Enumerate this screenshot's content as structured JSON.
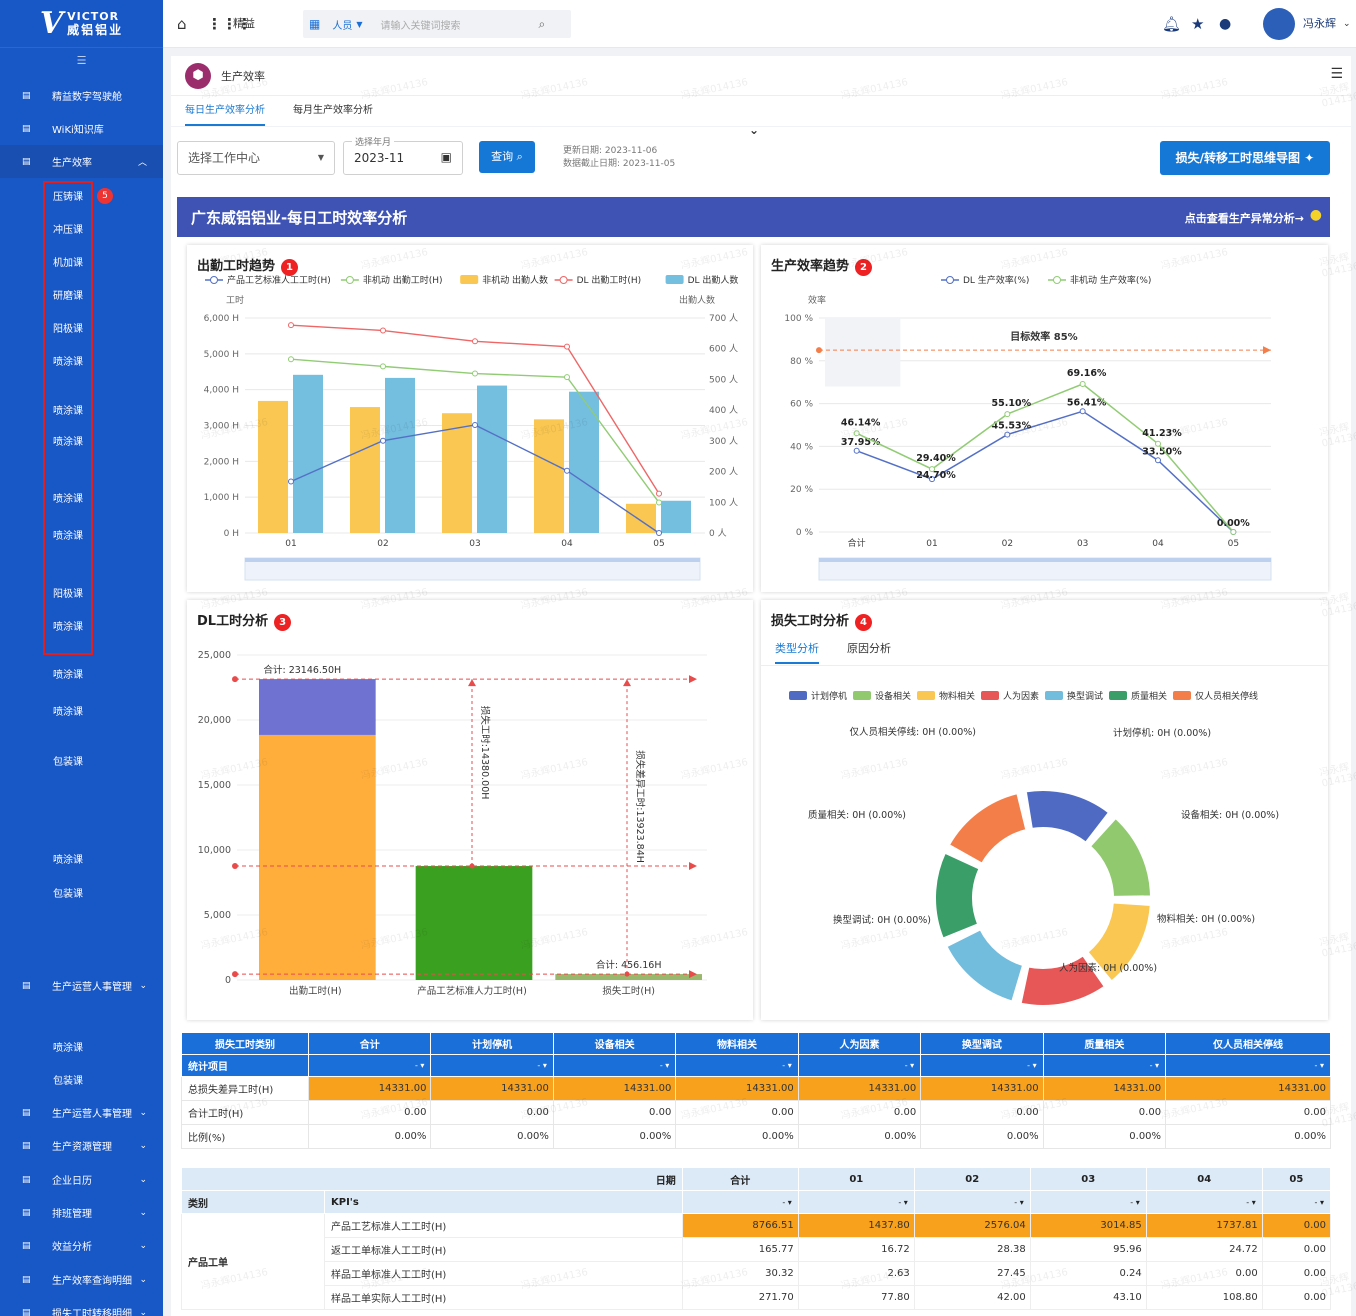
{
  "brand": {
    "logo_line1": "VICTOR",
    "logo_line2": "威铝铝业"
  },
  "sidebar": {
    "items": [
      {
        "label": "精益数字驾驶舱",
        "top": 79
      },
      {
        "label": "WiKi知识库",
        "top": 112
      },
      {
        "label": "生产效率",
        "top": 145,
        "expanded": true
      },
      {
        "label": "生产运营人事管理",
        "top": 969
      },
      {
        "label": "生产运营人事管理",
        "top": 1096
      },
      {
        "label": "生产资源管理",
        "top": 1129
      },
      {
        "label": "企业日历",
        "top": 1163
      },
      {
        "label": "排班管理",
        "top": 1196
      },
      {
        "label": "效益分析",
        "top": 1229
      },
      {
        "label": "生产效率查询明细",
        "top": 1263
      },
      {
        "label": "损失工时转移明细",
        "top": 1296
      }
    ],
    "subitems": [
      {
        "label": "压铸课",
        "top": 179
      },
      {
        "label": "冲压课",
        "top": 212
      },
      {
        "label": "机加课",
        "top": 245
      },
      {
        "label": "研磨课",
        "top": 278
      },
      {
        "label": "阳极课",
        "top": 311
      },
      {
        "label": "喷涂课",
        "top": 344
      },
      {
        "label": "喷涂课",
        "top": 393
      },
      {
        "label": "喷涂课",
        "top": 424
      },
      {
        "label": "喷涂课",
        "top": 481
      },
      {
        "label": "喷涂课",
        "top": 518
      },
      {
        "label": "阳极课",
        "top": 576
      },
      {
        "label": "喷涂课",
        "top": 609
      },
      {
        "label": "喷涂课",
        "top": 657
      },
      {
        "label": "喷涂课",
        "top": 694
      },
      {
        "label": "包装课",
        "top": 744
      },
      {
        "label": "喷涂课",
        "top": 842
      },
      {
        "label": "包装课",
        "top": 876
      },
      {
        "label": "喷涂课",
        "top": 1030
      },
      {
        "label": "包装课",
        "top": 1063
      }
    ],
    "badge": "5"
  },
  "topbar": {
    "module": "精益",
    "search_scope": "人员",
    "search_placeholder": "请输入关键词搜索",
    "user": "冯永辉"
  },
  "page": {
    "breadcrumb": "生产效率",
    "tabs": [
      "每日生产效率分析",
      "每月生产效率分析"
    ],
    "active_tab": 0
  },
  "filters": {
    "work_center_placeholder": "选择工作中心",
    "month_label": "选择年月",
    "month_value": "2023-11",
    "query_label": "查询",
    "update_date": "更新日期: 2023-11-06",
    "cutoff_date": "数据截止日期: 2023-11-05",
    "mindmap_button": "损失/转移工时思维导图"
  },
  "banner": {
    "title": "广东威铝铝业-每日工时效率分析",
    "link": "点击查看生产异常分析→"
  },
  "panels": {
    "p1": {
      "title": "出勤工时趋势",
      "badge": "1"
    },
    "p2": {
      "title": "生产效率趋势",
      "badge": "2"
    },
    "p3": {
      "title": "DL工时分析",
      "badge": "3"
    },
    "p4": {
      "title": "损失工时分析",
      "badge": "4",
      "tabs": [
        "类型分析",
        "原因分析"
      ]
    }
  },
  "chart_data": [
    {
      "type": "bar",
      "title": "出勤工时趋势",
      "categories": [
        "01",
        "02",
        "03",
        "04",
        "05"
      ],
      "ylabel": "工时",
      "ylabel_right": "出勤人数",
      "y_ticks": [
        "6,000 H",
        "5,000 H",
        "4,000 H",
        "3,000 H",
        "2,000 H",
        "1,000 H",
        "0 H"
      ],
      "y2_ticks": [
        "700 人",
        "600 人",
        "500 人",
        "400 人",
        "300 人",
        "200 人",
        "100 人",
        "0 人"
      ],
      "ylim": [
        0,
        6000
      ],
      "y2lim": [
        0,
        700
      ],
      "legend": [
        "产品工艺标准人工工时(H)",
        "非机动 出勤工时(H)",
        "非机动 出勤人数",
        "DL 出勤工时(H)",
        "DL 出勤人数"
      ],
      "series": [
        {
          "name": "非机动 出勤人数",
          "kind": "bar",
          "axis": "right",
          "color": "#f9c752",
          "values": [
            430,
            410,
            390,
            370,
            95
          ]
        },
        {
          "name": "DL 出勤人数",
          "kind": "bar",
          "axis": "right",
          "color": "#74bedf",
          "values": [
            515,
            505,
            480,
            460,
            105
          ]
        },
        {
          "name": "产品工艺标准人工工时(H)",
          "kind": "line",
          "axis": "left",
          "color": "#5470c6",
          "values": [
            1438,
            2576,
            3015,
            1738,
            0
          ]
        },
        {
          "name": "非机动 出勤工时(H)",
          "kind": "line",
          "axis": "left",
          "color": "#91cc75",
          "values": [
            4850,
            4650,
            4450,
            4350,
            850
          ]
        },
        {
          "name": "DL 出勤工时(H)",
          "kind": "line",
          "axis": "left",
          "color": "#ee6666",
          "values": [
            5800,
            5650,
            5350,
            5200,
            1100
          ]
        }
      ]
    },
    {
      "type": "line",
      "title": "生产效率趋势",
      "categories": [
        "合计",
        "01",
        "02",
        "03",
        "04",
        "05"
      ],
      "ylabel": "效率",
      "y_ticks": [
        "100 %",
        "80 %",
        "60 %",
        "40 %",
        "20 %",
        "0 %"
      ],
      "ylim": [
        0,
        100
      ],
      "target_label": "目标效率 85%",
      "target": 85,
      "series": [
        {
          "name": "DL 生产效率(%)",
          "color": "#5470c6",
          "values": [
            37.95,
            24.7,
            45.53,
            56.41,
            33.5,
            0.0
          ],
          "labels": [
            "37.95%",
            "24.70%",
            "45.53%",
            "56.41%",
            "33.50%",
            "0.00%"
          ]
        },
        {
          "name": "非机动 生产效率(%)",
          "color": "#91cc75",
          "values": [
            46.14,
            29.4,
            55.1,
            69.16,
            41.23,
            0.0
          ],
          "labels": [
            "46.14%",
            "29.40%",
            "55.10%",
            "69.16%",
            "41.23%",
            ""
          ]
        }
      ]
    },
    {
      "type": "bar",
      "title": "DL工时分析",
      "categories": [
        "出勤工时(H)",
        "产品工艺标准人力工时(H)",
        "损失工时(H)"
      ],
      "y_ticks": [
        "25,000",
        "20,000",
        "15,000",
        "10,000",
        "5,000",
        "0"
      ],
      "ylim": [
        0,
        25000
      ],
      "stacks": [
        [
          {
            "value": 18850,
            "color": "#ffae3b"
          },
          {
            "value": 4296.5,
            "color": "#6f72d0"
          }
        ],
        [
          {
            "value": 8766.51,
            "color": "#3aa020"
          }
        ],
        [
          {
            "value": 456.16,
            "color": "#9ab86b"
          }
        ]
      ],
      "totals": [
        "合计: 23146.50H",
        "",
        "合计: 456.16H"
      ],
      "annotations": [
        "损失工时:14380.00H",
        "损失差异工时:13923.84H"
      ]
    },
    {
      "type": "pie",
      "title": "损失工时分析",
      "legend": [
        "计划停机",
        "设备相关",
        "物料相关",
        "人为因素",
        "换型调试",
        "质量相关",
        "仅人员相关停线"
      ],
      "colors": [
        "#4e6ac3",
        "#91c96f",
        "#f9c752",
        "#e85757",
        "#72bcde",
        "#3a9e68",
        "#f47e4a"
      ],
      "values": [
        0,
        0,
        0,
        0,
        0,
        0,
        0
      ],
      "labels": [
        "计划停机: 0H (0.00%)",
        "设备相关: 0H (0.00%)",
        "物料相关: 0H (0.00%)",
        "人为因素: 0H (0.00%)",
        "换型调试: 0H (0.00%)",
        "质量相关: 0H (0.00%)",
        "仅人员相关停线: 0H (0.00%)"
      ]
    }
  ],
  "table1": {
    "corner_top": "损失工时类别",
    "corner_bottom": "统计项目",
    "headers": [
      "合计",
      "计划停机",
      "设备相关",
      "物料相关",
      "人为因素",
      "换型调试",
      "质量相关",
      "仅人员相关停线"
    ],
    "rows": [
      {
        "label": "总损失差异工时(H)",
        "values": [
          "14331.00",
          "14331.00",
          "14331.00",
          "14331.00",
          "14331.00",
          "14331.00",
          "14331.00",
          "14331.00"
        ],
        "highlight": true
      },
      {
        "label": "合计工时(H)",
        "values": [
          "0.00",
          "0.00",
          "0.00",
          "0.00",
          "0.00",
          "0.00",
          "0.00",
          "0.00"
        ]
      },
      {
        "label": "比例(%)",
        "values": [
          "0.00%",
          "0.00%",
          "0.00%",
          "0.00%",
          "0.00%",
          "0.00%",
          "0.00%",
          "0.00%"
        ]
      }
    ]
  },
  "table2": {
    "date_label": "日期",
    "category_label": "类别",
    "kpi_label": "KPI's",
    "headers": [
      "合计",
      "01",
      "02",
      "03",
      "04",
      "05"
    ],
    "group": "产品工单",
    "rows": [
      {
        "label": "产品工艺标准人工工时(H)",
        "values": [
          "8766.51",
          "1437.80",
          "2576.04",
          "3014.85",
          "1737.81",
          "0.00"
        ],
        "highlight": true
      },
      {
        "label": "返工工单标准人工工时(H)",
        "values": [
          "165.77",
          "16.72",
          "28.38",
          "95.96",
          "24.72",
          "0.00"
        ]
      },
      {
        "label": "样品工单标准人工工时(H)",
        "values": [
          "30.32",
          "2.63",
          "27.45",
          "0.24",
          "0.00",
          "0.00"
        ]
      },
      {
        "label": "样品工单实际人工工时(H)",
        "values": [
          "271.70",
          "77.80",
          "42.00",
          "43.10",
          "108.80",
          "0.00"
        ]
      }
    ]
  },
  "watermark": "冯永辉014136"
}
